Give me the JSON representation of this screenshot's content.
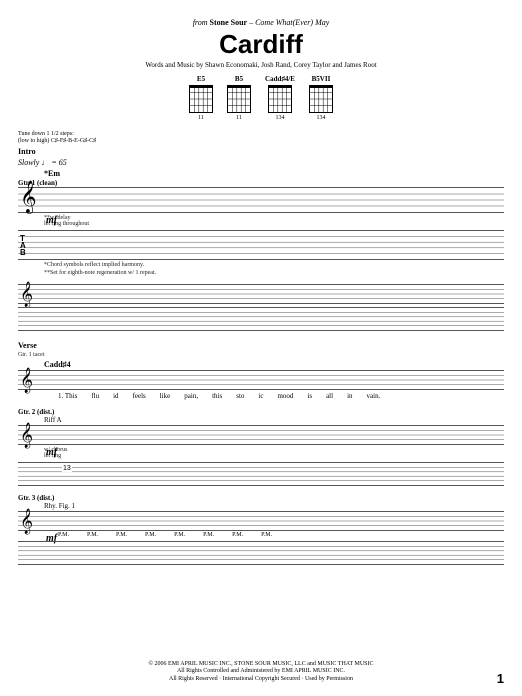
{
  "header": {
    "from_prefix": "from",
    "artist": "Stone Sour",
    "album": "Come What(Ever) May",
    "title": "Cardiff",
    "credits": "Words and Music by Shawn Economaki, Josh Rand, Corey Taylor and James Root"
  },
  "chords": [
    {
      "name": "E5",
      "fingering": "11"
    },
    {
      "name": "B5",
      "fingering": "11"
    },
    {
      "name": "Cadd♯4/E",
      "fingering": "134"
    },
    {
      "name": "B5VII",
      "fingering": "134"
    }
  ],
  "tuning": {
    "line1": "Tune down 1 1/2 steps:",
    "line2": "(low to high) C♯-F♯-B-E-G♯-C♯"
  },
  "sections": {
    "intro": {
      "label": "Intro",
      "tempo": "Slowly ♩ = 65",
      "key_chord": "*Em",
      "part1": "Gtr. 1 (clean)",
      "dynamic": "mf",
      "effect": "w/ delay",
      "technique": "let ring throughout",
      "footnote1": "*Chord symbols reflect implied harmony.",
      "footnote2": "**Set for eighth-note regeneration w/ 1 repeat."
    },
    "verse": {
      "label": "Verse",
      "part1": "Gtr. 1 tacet",
      "chord1": "Cadd♯4",
      "lyrics": [
        "1. This",
        "flu",
        "-",
        "id",
        "feels",
        "like",
        "pain,",
        "",
        "this",
        "sto",
        "-",
        "ic",
        "mood",
        "is",
        "all",
        "in",
        "vain."
      ],
      "gtr2": {
        "label": "Gtr. 2 (dist.)",
        "riff": "Riff A",
        "dynamic": "mf",
        "technique1": "w/ chorus",
        "technique2": "let ring",
        "tab_fret": "13"
      },
      "gtr3": {
        "label": "Gtr. 3 (dist.)",
        "riff": "Rhy. Fig. 1",
        "dynamic": "mf",
        "pm": "P.M."
      }
    }
  },
  "copyright": {
    "line1": "© 2006 EMI APRIL MUSIC INC., STONE SOUR MUSIC, LLC and MUSIC THAT MUSIC",
    "line2": "All Rights Controlled and Administered by EMI APRIL MUSIC INC.",
    "line3": "All Rights Reserved · International Copyright Secured · Used by Permission"
  },
  "page_number": "1"
}
